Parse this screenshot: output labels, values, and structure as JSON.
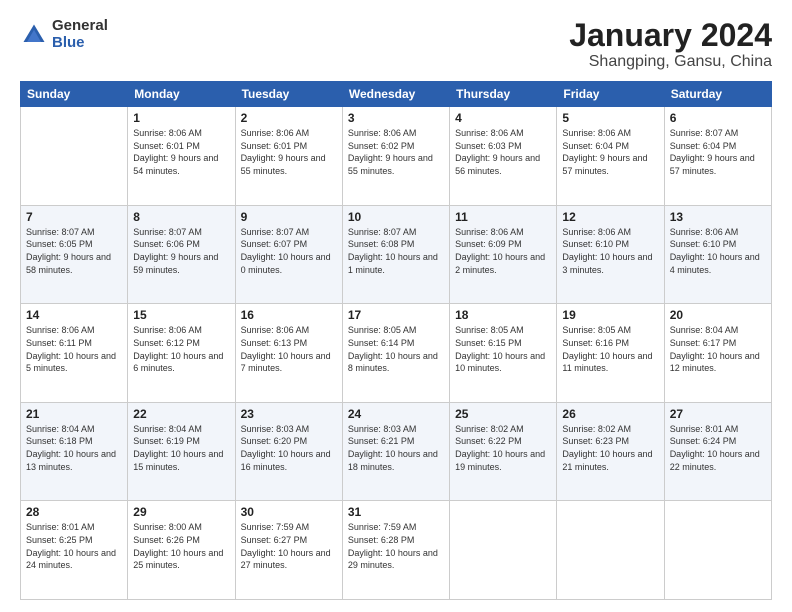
{
  "header": {
    "logo": {
      "general": "General",
      "blue": "Blue"
    },
    "title": "January 2024",
    "subtitle": "Shangping, Gansu, China"
  },
  "weekdays": [
    "Sunday",
    "Monday",
    "Tuesday",
    "Wednesday",
    "Thursday",
    "Friday",
    "Saturday"
  ],
  "weeks": [
    [
      {
        "day": "",
        "sunrise": "",
        "sunset": "",
        "daylight": ""
      },
      {
        "day": "1",
        "sunrise": "Sunrise: 8:06 AM",
        "sunset": "Sunset: 6:01 PM",
        "daylight": "Daylight: 9 hours and 54 minutes."
      },
      {
        "day": "2",
        "sunrise": "Sunrise: 8:06 AM",
        "sunset": "Sunset: 6:01 PM",
        "daylight": "Daylight: 9 hours and 55 minutes."
      },
      {
        "day": "3",
        "sunrise": "Sunrise: 8:06 AM",
        "sunset": "Sunset: 6:02 PM",
        "daylight": "Daylight: 9 hours and 55 minutes."
      },
      {
        "day": "4",
        "sunrise": "Sunrise: 8:06 AM",
        "sunset": "Sunset: 6:03 PM",
        "daylight": "Daylight: 9 hours and 56 minutes."
      },
      {
        "day": "5",
        "sunrise": "Sunrise: 8:06 AM",
        "sunset": "Sunset: 6:04 PM",
        "daylight": "Daylight: 9 hours and 57 minutes."
      },
      {
        "day": "6",
        "sunrise": "Sunrise: 8:07 AM",
        "sunset": "Sunset: 6:04 PM",
        "daylight": "Daylight: 9 hours and 57 minutes."
      }
    ],
    [
      {
        "day": "7",
        "sunrise": "Sunrise: 8:07 AM",
        "sunset": "Sunset: 6:05 PM",
        "daylight": "Daylight: 9 hours and 58 minutes."
      },
      {
        "day": "8",
        "sunrise": "Sunrise: 8:07 AM",
        "sunset": "Sunset: 6:06 PM",
        "daylight": "Daylight: 9 hours and 59 minutes."
      },
      {
        "day": "9",
        "sunrise": "Sunrise: 8:07 AM",
        "sunset": "Sunset: 6:07 PM",
        "daylight": "Daylight: 10 hours and 0 minutes."
      },
      {
        "day": "10",
        "sunrise": "Sunrise: 8:07 AM",
        "sunset": "Sunset: 6:08 PM",
        "daylight": "Daylight: 10 hours and 1 minute."
      },
      {
        "day": "11",
        "sunrise": "Sunrise: 8:06 AM",
        "sunset": "Sunset: 6:09 PM",
        "daylight": "Daylight: 10 hours and 2 minutes."
      },
      {
        "day": "12",
        "sunrise": "Sunrise: 8:06 AM",
        "sunset": "Sunset: 6:10 PM",
        "daylight": "Daylight: 10 hours and 3 minutes."
      },
      {
        "day": "13",
        "sunrise": "Sunrise: 8:06 AM",
        "sunset": "Sunset: 6:10 PM",
        "daylight": "Daylight: 10 hours and 4 minutes."
      }
    ],
    [
      {
        "day": "14",
        "sunrise": "Sunrise: 8:06 AM",
        "sunset": "Sunset: 6:11 PM",
        "daylight": "Daylight: 10 hours and 5 minutes."
      },
      {
        "day": "15",
        "sunrise": "Sunrise: 8:06 AM",
        "sunset": "Sunset: 6:12 PM",
        "daylight": "Daylight: 10 hours and 6 minutes."
      },
      {
        "day": "16",
        "sunrise": "Sunrise: 8:06 AM",
        "sunset": "Sunset: 6:13 PM",
        "daylight": "Daylight: 10 hours and 7 minutes."
      },
      {
        "day": "17",
        "sunrise": "Sunrise: 8:05 AM",
        "sunset": "Sunset: 6:14 PM",
        "daylight": "Daylight: 10 hours and 8 minutes."
      },
      {
        "day": "18",
        "sunrise": "Sunrise: 8:05 AM",
        "sunset": "Sunset: 6:15 PM",
        "daylight": "Daylight: 10 hours and 10 minutes."
      },
      {
        "day": "19",
        "sunrise": "Sunrise: 8:05 AM",
        "sunset": "Sunset: 6:16 PM",
        "daylight": "Daylight: 10 hours and 11 minutes."
      },
      {
        "day": "20",
        "sunrise": "Sunrise: 8:04 AM",
        "sunset": "Sunset: 6:17 PM",
        "daylight": "Daylight: 10 hours and 12 minutes."
      }
    ],
    [
      {
        "day": "21",
        "sunrise": "Sunrise: 8:04 AM",
        "sunset": "Sunset: 6:18 PM",
        "daylight": "Daylight: 10 hours and 13 minutes."
      },
      {
        "day": "22",
        "sunrise": "Sunrise: 8:04 AM",
        "sunset": "Sunset: 6:19 PM",
        "daylight": "Daylight: 10 hours and 15 minutes."
      },
      {
        "day": "23",
        "sunrise": "Sunrise: 8:03 AM",
        "sunset": "Sunset: 6:20 PM",
        "daylight": "Daylight: 10 hours and 16 minutes."
      },
      {
        "day": "24",
        "sunrise": "Sunrise: 8:03 AM",
        "sunset": "Sunset: 6:21 PM",
        "daylight": "Daylight: 10 hours and 18 minutes."
      },
      {
        "day": "25",
        "sunrise": "Sunrise: 8:02 AM",
        "sunset": "Sunset: 6:22 PM",
        "daylight": "Daylight: 10 hours and 19 minutes."
      },
      {
        "day": "26",
        "sunrise": "Sunrise: 8:02 AM",
        "sunset": "Sunset: 6:23 PM",
        "daylight": "Daylight: 10 hours and 21 minutes."
      },
      {
        "day": "27",
        "sunrise": "Sunrise: 8:01 AM",
        "sunset": "Sunset: 6:24 PM",
        "daylight": "Daylight: 10 hours and 22 minutes."
      }
    ],
    [
      {
        "day": "28",
        "sunrise": "Sunrise: 8:01 AM",
        "sunset": "Sunset: 6:25 PM",
        "daylight": "Daylight: 10 hours and 24 minutes."
      },
      {
        "day": "29",
        "sunrise": "Sunrise: 8:00 AM",
        "sunset": "Sunset: 6:26 PM",
        "daylight": "Daylight: 10 hours and 25 minutes."
      },
      {
        "day": "30",
        "sunrise": "Sunrise: 7:59 AM",
        "sunset": "Sunset: 6:27 PM",
        "daylight": "Daylight: 10 hours and 27 minutes."
      },
      {
        "day": "31",
        "sunrise": "Sunrise: 7:59 AM",
        "sunset": "Sunset: 6:28 PM",
        "daylight": "Daylight: 10 hours and 29 minutes."
      },
      {
        "day": "",
        "sunrise": "",
        "sunset": "",
        "daylight": ""
      },
      {
        "day": "",
        "sunrise": "",
        "sunset": "",
        "daylight": ""
      },
      {
        "day": "",
        "sunrise": "",
        "sunset": "",
        "daylight": ""
      }
    ]
  ]
}
